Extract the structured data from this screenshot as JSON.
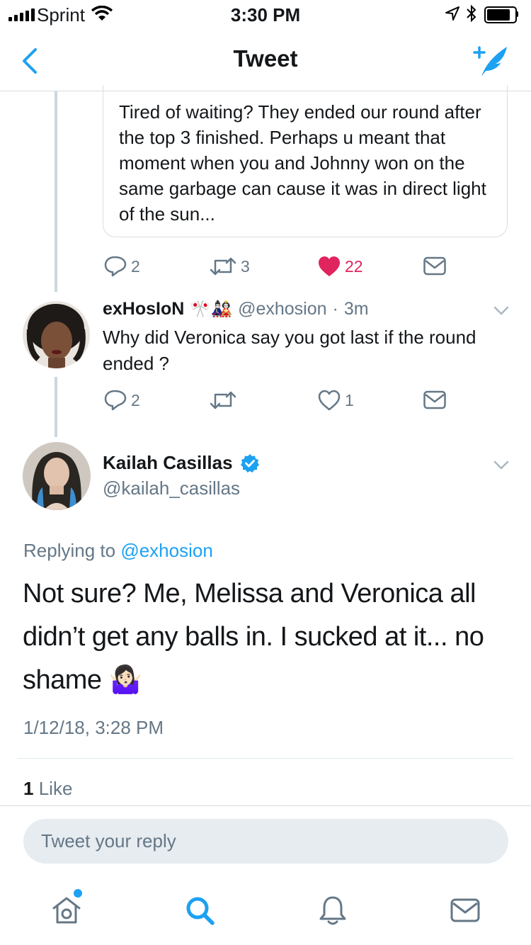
{
  "status_bar": {
    "carrier": "Sprint",
    "time": "3:30 PM"
  },
  "nav": {
    "title": "Tweet",
    "back_icon": "chevron-left-icon",
    "compose_icon": "compose-tweet-icon"
  },
  "quoted_tweet": {
    "text": "Tired of waiting? They ended our round after the top 3 finished. Perhaps u meant that moment when you and Johnny won on the same garbage can cause it was in direct light of the sun...",
    "actions": {
      "reply_count": "2",
      "retweet_count": "3",
      "like_count": "22",
      "liked": true
    }
  },
  "reply_tweet": {
    "name": "exHosIoN",
    "emojis": "🎌🎎",
    "handle": "@exhosion",
    "separator": "·",
    "time": "3m",
    "text": "Why did Veronica say you got last if the round ended ?",
    "actions": {
      "reply_count": "2",
      "retweet_count": "",
      "like_count": "1",
      "liked": false
    }
  },
  "main_tweet": {
    "name": "Kailah Casillas",
    "verified": true,
    "handle": "@kailah_casillas",
    "replying_prefix": "Replying to",
    "replying_to": "@exhosion",
    "text": "Not sure? Me, Melissa and Veronica all didn’t get any balls in. I sucked at it... no shame 🤷🏻‍♀️",
    "timestamp": "1/12/18, 3:28 PM",
    "likes_count": "1",
    "likes_label": "Like"
  },
  "reply_input": {
    "placeholder": "Tweet your reply"
  },
  "tab_bar": {
    "items": [
      "home-icon",
      "search-icon",
      "notifications-icon",
      "messages-icon"
    ],
    "active": "search",
    "home_has_dot": true
  },
  "colors": {
    "accent": "#1da1f2",
    "like": "#e0245e",
    "secondary_text": "#657786",
    "divider": "#e1e8ed"
  }
}
